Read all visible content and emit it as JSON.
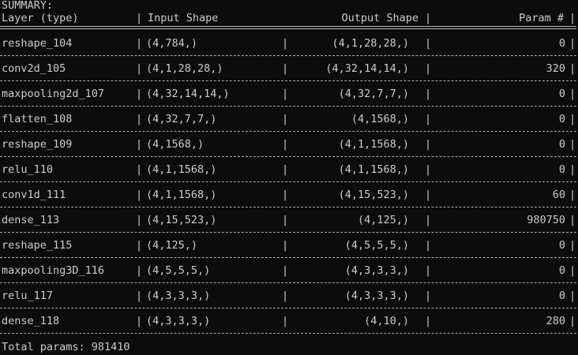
{
  "summary_label": "SUMMARY:",
  "headers": {
    "layer": "Layer (type)",
    "input": "Input Shape",
    "output": "Output Shape",
    "params": "Param #"
  },
  "column_separator": "|",
  "rows": [
    {
      "name": "reshape_104",
      "input": "(4,784,)",
      "output": "(4,1,28,28,)",
      "params": "0"
    },
    {
      "name": "conv2d_105",
      "input": "(4,1,28,28,)",
      "output": "(4,32,14,14,)",
      "params": "320"
    },
    {
      "name": "maxpooling2d_107",
      "input": "(4,32,14,14,)",
      "output": "(4,32,7,7,)",
      "params": "0"
    },
    {
      "name": "flatten_108",
      "input": "(4,32,7,7,)",
      "output": "(4,1568,)",
      "params": "0"
    },
    {
      "name": "reshape_109",
      "input": "(4,1568,)",
      "output": "(4,1,1568,)",
      "params": "0"
    },
    {
      "name": "relu_110",
      "input": "(4,1,1568,)",
      "output": "(4,1,1568,)",
      "params": "0"
    },
    {
      "name": "conv1d_111",
      "input": "(4,1,1568,)",
      "output": "(4,15,523,)",
      "params": "60"
    },
    {
      "name": "dense_113",
      "input": "(4,15,523,)",
      "output": "(4,125,)",
      "params": "980750"
    },
    {
      "name": "reshape_115",
      "input": "(4,125,)",
      "output": "(4,5,5,5,)",
      "params": "0"
    },
    {
      "name": "maxpooling3D_116",
      "input": "(4,5,5,5,)",
      "output": "(4,3,3,3,)",
      "params": "0"
    },
    {
      "name": "relu_117",
      "input": "(4,3,3,3,)",
      "output": "(4,3,3,3,)",
      "params": "0"
    },
    {
      "name": "dense_118",
      "input": "(4,3,3,3,)",
      "output": "(4,10,)",
      "params": "280"
    }
  ],
  "total_params": "Total params: 981410"
}
